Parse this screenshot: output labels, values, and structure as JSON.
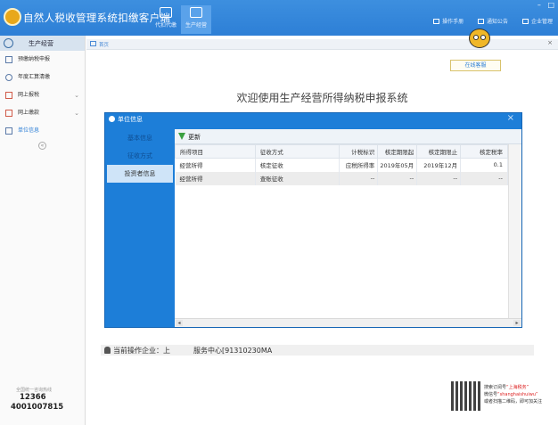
{
  "app": {
    "title": "自然人税收管理系统扣缴客户端",
    "nav": [
      {
        "label": "代扣代缴"
      },
      {
        "label": "生产经营"
      }
    ],
    "right_links": [
      "操作手册",
      "通知公告",
      "企业管理"
    ],
    "window_controls": [
      "–",
      "□"
    ]
  },
  "sidebar": {
    "header": "生产经营",
    "items": [
      {
        "label": "预缴纳税申报",
        "icon": "form-icon"
      },
      {
        "label": "年度汇算清缴",
        "icon": "clock-icon"
      },
      {
        "label": "网上报税",
        "icon": "send-icon",
        "has_chevron": true
      },
      {
        "label": "网上缴款",
        "icon": "payment-icon",
        "has_chevron": true
      },
      {
        "label": "单位信息",
        "icon": "info-icon",
        "active": true
      }
    ],
    "collapse": "«",
    "hotline_label": "全国统一咨询热线",
    "hotlines": [
      "12366",
      "4001007815"
    ]
  },
  "content": {
    "breadcrumb": "首页",
    "close": "×",
    "online_service": "在线客服",
    "welcome": "欢迎使用生产经营所得纳税申报系统"
  },
  "modal": {
    "title": "单位信息",
    "close": "×",
    "nav": [
      {
        "label": "基本信息"
      },
      {
        "label": "征收方式"
      },
      {
        "label": "投资者信息",
        "active": true
      }
    ],
    "refresh": "更新",
    "table": {
      "headers": [
        "所得项目",
        "征收方式",
        "计税标识",
        "核定期限起",
        "核定期限止",
        "核定税率"
      ],
      "rows": [
        [
          "经营所得",
          "核定征收",
          "应税所得率",
          "2019年05月",
          "2019年12月",
          "0.1"
        ],
        [
          "经营所得",
          "查账征收",
          "--",
          "--",
          "--",
          "--"
        ]
      ]
    },
    "scroll_left": "◂",
    "scroll_right": "▸"
  },
  "current_company": {
    "label": "当前操作企业：上",
    "value_tail": "服务中心[91310230MA"
  },
  "qr": {
    "line1_prefix": "搜索订阅号",
    "line1_highlight": "“上海税务”",
    "line2_prefix": "微信号",
    "line2_highlight": "“shanghaishuiwu”",
    "line3": "或者扫描二维码，即可加关注"
  },
  "colors": {
    "header": "#2d7fd6",
    "modal_nav": "#1d7ed8",
    "accent_red": "#d22222"
  }
}
